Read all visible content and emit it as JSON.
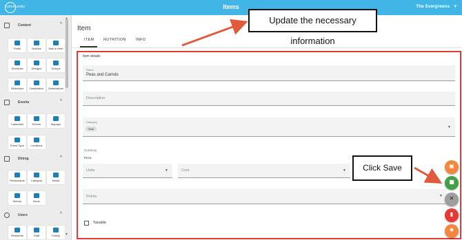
{
  "header": {
    "logo_text": "community",
    "title": "Items",
    "community_name": "The Evergreens",
    "community_caret": "▾",
    "bar_color": "#41b6e6"
  },
  "sidebar": {
    "sections": [
      {
        "label": "Content",
        "icon": "content-icon",
        "items": [
          "Posts",
          "Notices",
          "Mail is Here",
          "Shortcuts",
          "Designs",
          "Groups",
          "Slideshow",
          "Destination",
          "Destinations"
        ]
      },
      {
        "label": "Events",
        "icon": "calendar-icon",
        "items": [
          "Calendars",
          "Events",
          "Signups",
          "Event Type",
          "Locations"
        ]
      },
      {
        "label": "Dining",
        "icon": "dining-icon",
        "items": [
          "Restaurants",
          "Category",
          "Meals",
          "Menus",
          "Items"
        ]
      },
      {
        "label": "Users",
        "icon": "user-icon",
        "items": [
          "Residents",
          "Staff",
          "Family"
        ]
      }
    ]
  },
  "main": {
    "title": "Item",
    "tabs": [
      "ITEM",
      "NUTRITION",
      "INFO"
    ],
    "active_tab": "ITEM",
    "form": {
      "caption": "Item details",
      "name_label": "Name",
      "name_value": "Peas and Carrots",
      "description_placeholder": "Description",
      "category_label": "Category",
      "category_chip": "Side",
      "currency_label": "Currency",
      "price_label": "Price",
      "units_placeholder": "Units",
      "cost_placeholder": "Cost",
      "points_placeholder": "Points",
      "taxable_label": "Taxable"
    },
    "highlight_color": "#e53935"
  },
  "fabs": [
    {
      "name": "calendar-add",
      "icon": "calendar-add-icon",
      "glyph": "▣",
      "color": "#f4873f"
    },
    {
      "name": "save",
      "icon": "save-icon",
      "glyph": "■",
      "color": "#43a047"
    },
    {
      "name": "disable",
      "icon": "no-edit-icon",
      "glyph": "✕",
      "color": "#9e9e9e"
    },
    {
      "name": "delete",
      "icon": "trash-icon",
      "glyph": "▮",
      "color": "#e53935"
    },
    {
      "name": "settings",
      "icon": "gear-icon",
      "glyph": "✹",
      "color": "#f4873f"
    }
  ],
  "annotations": {
    "update": "Update the necessary information",
    "save": "Click Save",
    "arrow_color": "#e05a3c"
  }
}
